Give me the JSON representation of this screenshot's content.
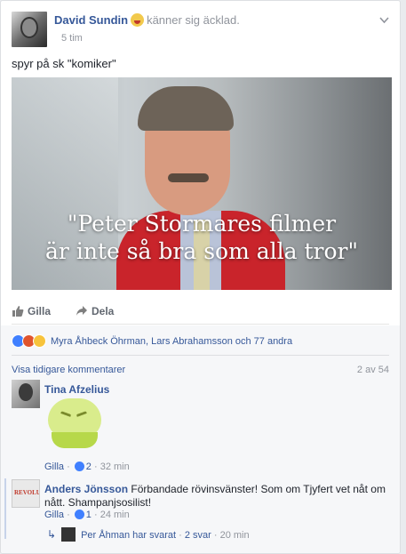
{
  "post": {
    "author": "David Sundin",
    "feeling": "känner sig äcklad.",
    "time": "5 tim",
    "status_text": "spyr på sk \"komiker\"",
    "image_quote_line1": "\"Peter Stormares filmer",
    "image_quote_line2": "är inte så bra som alla tror\""
  },
  "actions": {
    "like": "Gilla",
    "share": "Dela"
  },
  "reactions": {
    "summary": "Myra Åhbeck Öhrman, Lars Abrahamsson och 77 andra"
  },
  "comments_header": {
    "view_previous": "Visa tidigare kommentarer",
    "count": "2 av 54"
  },
  "comments": [
    {
      "name": "Tina Afzelius",
      "like_label": "Gilla",
      "reaction_count": "2",
      "time": "32 min"
    },
    {
      "name": "Anders Jönsson",
      "text": " Förbandade rövinsvänster! Som om Tjyfert vet nåt om nått. Shampanjsosilist!",
      "like_label": "Gilla",
      "reaction_count": "1",
      "time": "24 min",
      "reply_summary": "Per Åhman har svarat",
      "reply_count": "2 svar",
      "reply_time": "20 min"
    }
  ],
  "colors": {
    "link": "#365899",
    "accent_like": "#4080ff",
    "meta": "#90949c"
  },
  "icons": [
    "chevron-down-icon",
    "thumbs-up-icon",
    "share-arrow-icon",
    "reply-arrow-icon",
    "sick-emoji-icon"
  ]
}
